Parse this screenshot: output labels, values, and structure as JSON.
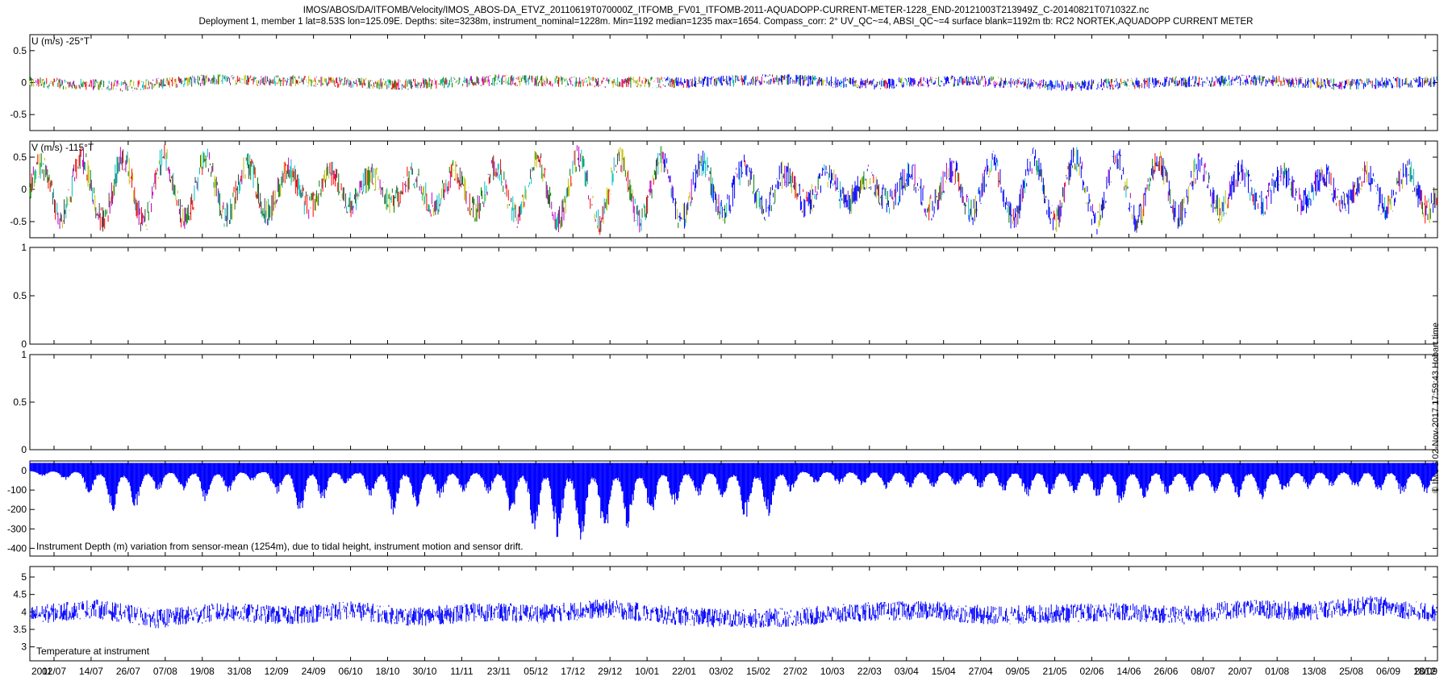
{
  "titles": {
    "line1": "IMOS/ABOS/DA/ITFOMB/Velocity/IMOS_ABOS-DA_ETVZ_20110619T070000Z_ITFOMB_FV01_ITFOMB-2011-AQUADOPP-CURRENT-METER-1228_END-20121003T213949Z_C-20140821T071032Z.nc",
    "line2": "Deployment 1, member 1 lat=8.53S lon=125.09E. Depths: site=3238m, instrument_nominal=1228m. Min=1192 median=1235 max=1654. Compass_corr: 2° UV_QC~=4, ABSI_QC~=4 surface blank=1192m tb: RC2 NORTEK,AQUADOPP CURRENT METER"
  },
  "stamp": "© IMOS 02-Nov-2017 17:59:43 Hobart time",
  "colors": {
    "series_main": "#0000ff",
    "palette": [
      "#ff0000",
      "#00bfbf",
      "#bf00bf",
      "#bfbf00",
      "#008000",
      "#404040",
      "#0000ff"
    ]
  },
  "chart_data": [
    {
      "type": "line",
      "title": "U (m/s) -25°T",
      "ylim": [
        -0.75,
        0.75
      ],
      "yticks": [
        "0.5",
        "0",
        "-0.5"
      ],
      "ytick_values": [
        0.5,
        0,
        -0.5
      ],
      "x_range": [
        "2011-06-19",
        "2012-10-03"
      ],
      "series": [
        {
          "values": [
            0.0,
            -0.05,
            0.05,
            0.02,
            -0.03,
            0.04,
            0.01,
            0.0,
            0.05,
            -0.02,
            0.03,
            -0.05,
            0.0,
            0.04,
            -0.03,
            0.02
          ]
        }
      ]
    },
    {
      "type": "line",
      "title": "V (m/s) -115°T",
      "ylim": [
        -0.75,
        0.75
      ],
      "yticks": [
        "0.5",
        "0",
        "-0.5"
      ],
      "ytick_values": [
        0.5,
        0,
        -0.5
      ],
      "series": [
        {
          "values": [
            0.05,
            -0.2,
            0.3,
            -0.3,
            0.35,
            -0.35,
            0.3,
            -0.2,
            0.4,
            -0.4,
            0.3,
            -0.3,
            0.35,
            -0.3,
            0.3,
            -0.25
          ]
        }
      ]
    },
    {
      "type": "line",
      "title": "",
      "ylim": [
        0,
        1
      ],
      "yticks": [
        "1",
        "0.5",
        "0"
      ],
      "ytick_values": [
        1,
        0.5,
        0
      ],
      "series": []
    },
    {
      "type": "line",
      "title": "",
      "ylim": [
        0,
        1
      ],
      "yticks": [
        "1",
        "0.5",
        "0"
      ],
      "ytick_values": [
        1,
        0.5,
        0
      ],
      "series": []
    },
    {
      "type": "line",
      "title": "Instrument Depth (m) variation from sensor-mean (1254m), due to tidal height, instrument motion and sensor drift.",
      "ylim": [
        -440,
        50
      ],
      "yticks": [
        "0",
        "-100",
        "-200",
        "-300",
        "-400"
      ],
      "ytick_values": [
        0,
        -100,
        -200,
        -300,
        -400
      ],
      "series": [
        {
          "values": [
            -20,
            -60,
            -260,
            -80,
            -180,
            -40,
            -240,
            -60,
            -230,
            -150,
            -100,
            -320,
            -390,
            -330,
            -210,
            -120,
            -310,
            -60,
            -80,
            -100,
            -90,
            -100,
            -140,
            -120,
            -180,
            -140,
            -110,
            -160,
            -100,
            -90,
            -130,
            -120
          ]
        }
      ]
    },
    {
      "type": "line",
      "title": "Temperature at instrument",
      "ylim": [
        2.6,
        5.3
      ],
      "yticks": [
        "5",
        "4.5",
        "4",
        "3.5",
        "3"
      ],
      "ytick_values": [
        5,
        4.5,
        4,
        3.5,
        3
      ],
      "series": [
        {
          "values": [
            3.9,
            4.1,
            3.8,
            4.0,
            3.9,
            4.05,
            3.85,
            4.0,
            3.95,
            4.1,
            3.9,
            3.8,
            3.85,
            4.0,
            4.05,
            3.9,
            3.95,
            4.0,
            3.9,
            4.1,
            4.0,
            4.2,
            3.95
          ]
        }
      ]
    }
  ],
  "xaxis": {
    "year_start": "2011",
    "year_end": "2012",
    "labels": [
      "02/07",
      "14/07",
      "26/07",
      "07/08",
      "19/08",
      "31/08",
      "12/09",
      "24/09",
      "06/10",
      "18/10",
      "30/10",
      "11/11",
      "23/11",
      "05/12",
      "17/12",
      "29/12",
      "10/01",
      "22/01",
      "03/02",
      "15/02",
      "27/02",
      "10/03",
      "22/03",
      "03/04",
      "15/04",
      "27/04",
      "09/05",
      "21/05",
      "02/06",
      "14/06",
      "26/06",
      "08/07",
      "20/07",
      "01/08",
      "13/08",
      "25/08",
      "06/09",
      "18/09"
    ]
  }
}
